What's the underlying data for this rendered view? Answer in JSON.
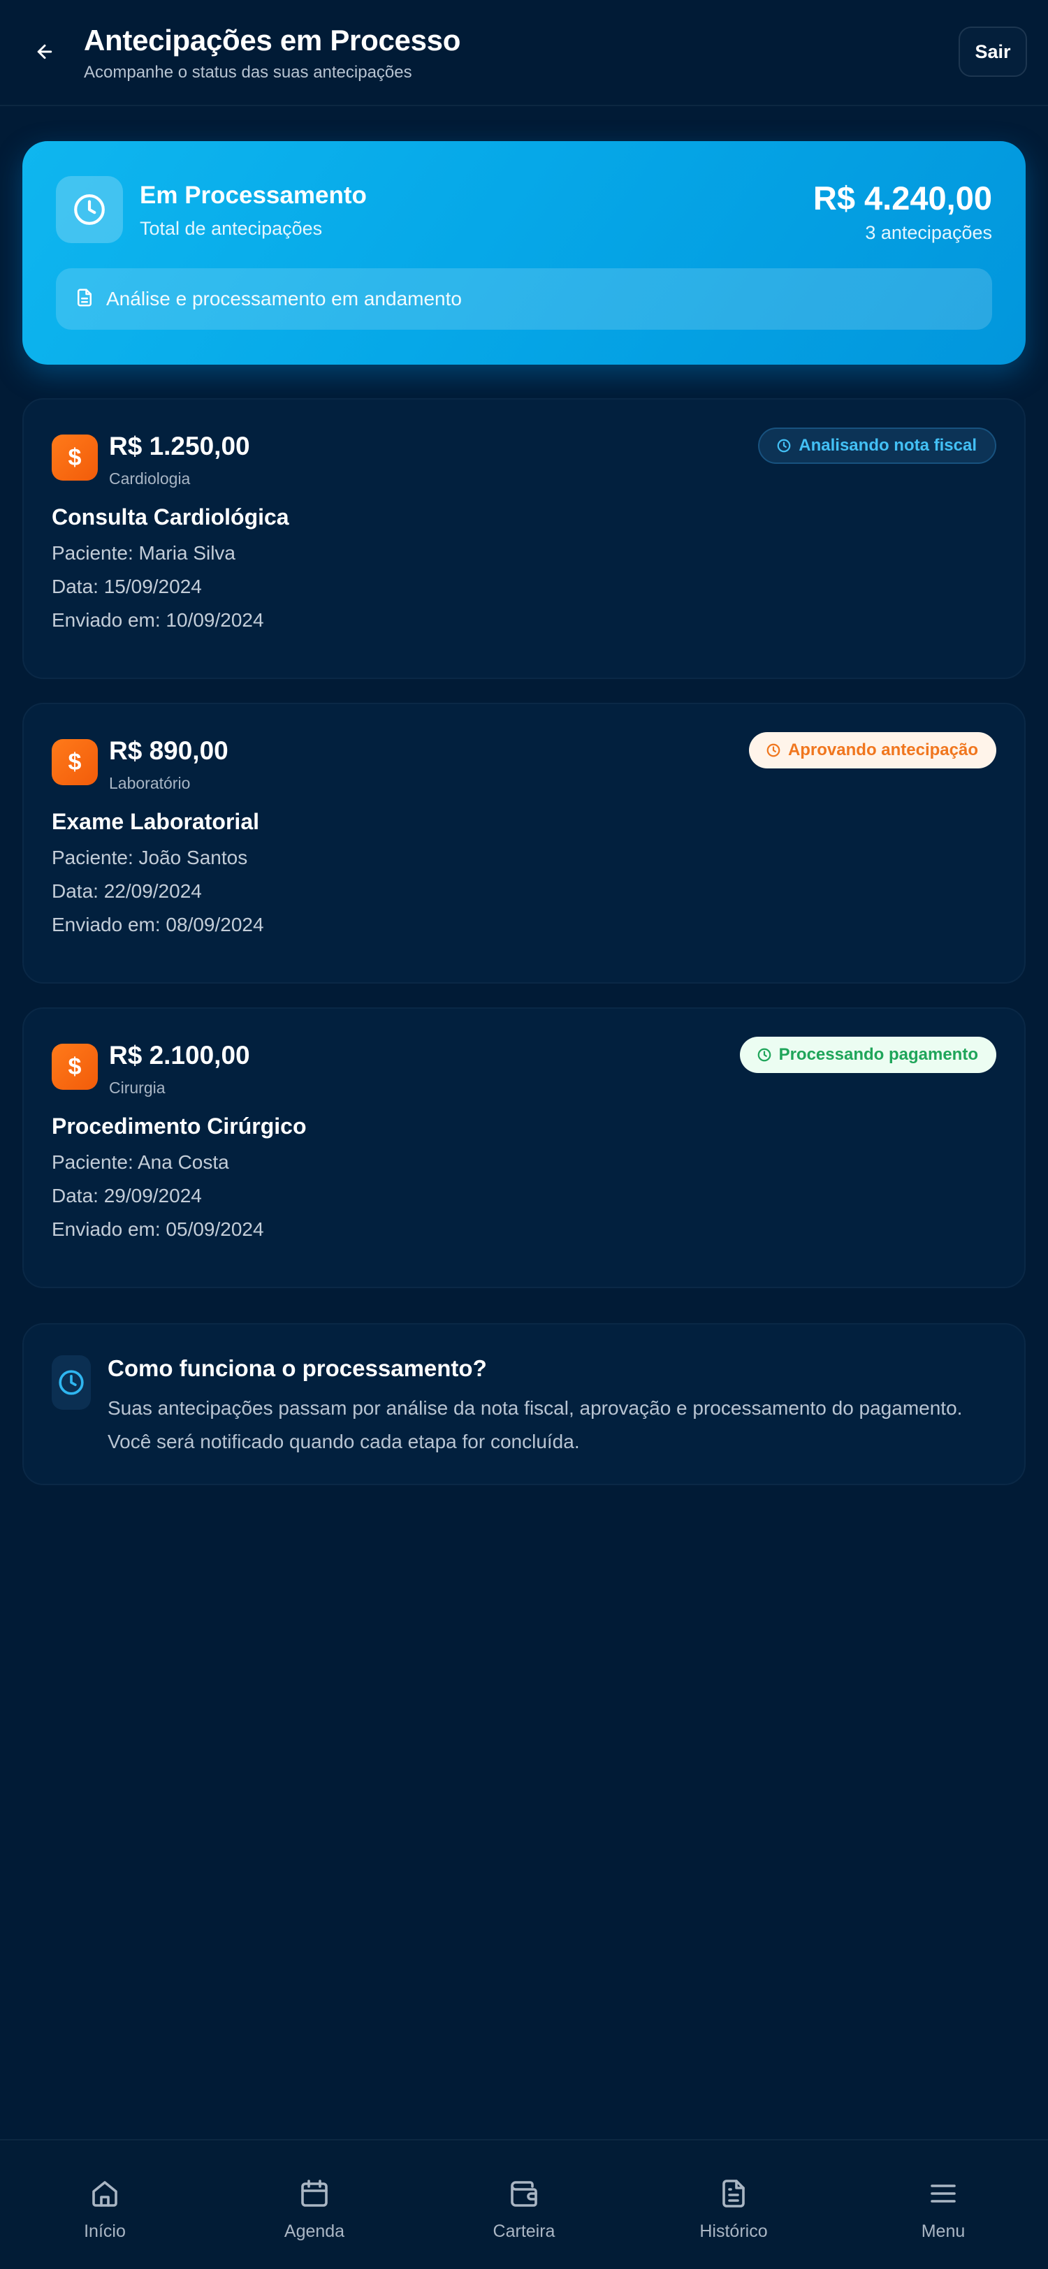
{
  "header": {
    "title": "Antecipações em Processo",
    "subtitle": "Acompanhe o status das suas antecipações",
    "logout_label": "Sair",
    "back_icon": "arrow-left-icon"
  },
  "summary": {
    "title": "Em Processamento",
    "subtitle": "Total de antecipações",
    "total": "R$ 4.240,00",
    "count": "3 antecipações",
    "status_text": "Análise e processamento em andamento",
    "icon": "clock-icon",
    "status_icon": "document-icon",
    "accent_color": "#06a8e8"
  },
  "anticipations": [
    {
      "amount": "R$ 1.250,00",
      "category": "Cardiologia",
      "title": "Consulta Cardiológica",
      "patient": "Paciente: Maria Silva",
      "date": "Data: 15/09/2024",
      "sent": "Enviado em: 10/09/2024",
      "status": "Analisando nota fiscal",
      "status_color": "#43c0f5",
      "icon": "dollar-icon"
    },
    {
      "amount": "R$ 890,00",
      "category": "Laboratório",
      "title": "Exame Laboratorial",
      "patient": "Paciente: João Santos",
      "date": "Data: 22/09/2024",
      "sent": "Enviado em: 08/09/2024",
      "status": "Aprovando antecipação",
      "status_color": "#f0761e",
      "icon": "dollar-icon"
    },
    {
      "amount": "R$ 2.100,00",
      "category": "Cirurgia",
      "title": "Procedimento Cirúrgico",
      "patient": "Paciente: Ana Costa",
      "date": "Data: 29/09/2024",
      "sent": "Enviado em: 05/09/2024",
      "status": "Processando pagamento",
      "status_color": "#1fa55a",
      "icon": "dollar-icon"
    }
  ],
  "info": {
    "title": "Como funciona o processamento?",
    "text": "Suas antecipações passam por análise da nota fiscal, aprovação e processamento do pagamento. Você será notificado quando cada etapa for concluída.",
    "icon": "clock-icon"
  },
  "nav": [
    {
      "label": "Início",
      "icon": "home-icon"
    },
    {
      "label": "Agenda",
      "icon": "calendar-icon"
    },
    {
      "label": "Carteira",
      "icon": "wallet-icon"
    },
    {
      "label": "Histórico",
      "icon": "file-text-icon"
    },
    {
      "label": "Menu",
      "icon": "menu-icon"
    }
  ]
}
